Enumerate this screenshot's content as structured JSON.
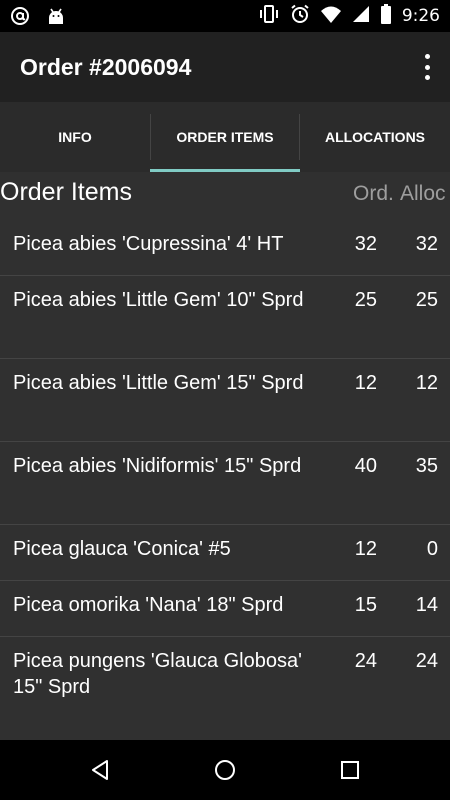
{
  "status_bar": {
    "time": "9:26",
    "left_icons": [
      "at-sign-icon",
      "android-icon"
    ],
    "right_icons": [
      "vibrate-icon",
      "alarm-icon",
      "wifi-icon",
      "cell-signal-icon",
      "battery-icon"
    ]
  },
  "app_bar": {
    "title": "Order #2006094",
    "overflow_icon": "more-vert-icon"
  },
  "tabs": [
    {
      "label": "INFO",
      "selected": false
    },
    {
      "label": "ORDER ITEMS",
      "selected": true
    },
    {
      "label": "ALLOCATIONS",
      "selected": false
    }
  ],
  "section": {
    "title": "Order Items",
    "col_ord": "Ord.",
    "col_alloc": "Alloc"
  },
  "items": [
    {
      "name": "Picea abies 'Cupressina' 4' HT",
      "ord": "32",
      "alloc": "32"
    },
    {
      "name": "Picea abies 'Little Gem' 10\" Sprd",
      "ord": "25",
      "alloc": "25"
    },
    {
      "name": "Picea abies 'Little Gem' 15\" Sprd",
      "ord": "12",
      "alloc": "12"
    },
    {
      "name": "Picea abies 'Nidiformis' 15\" Sprd",
      "ord": "40",
      "alloc": "35"
    },
    {
      "name": "Picea glauca 'Conica' #5",
      "ord": "12",
      "alloc": "0"
    },
    {
      "name": "Picea omorika 'Nana' 18\" Sprd",
      "ord": "15",
      "alloc": "14"
    },
    {
      "name": "Picea pungens 'Glauca Globosa' 15\" Sprd",
      "ord": "24",
      "alloc": "24"
    }
  ],
  "nav_bar": {
    "icons": [
      "back-icon",
      "home-icon",
      "recents-icon"
    ]
  },
  "colors": {
    "accent": "#80cbc4",
    "background": "#303030",
    "app_bar": "#212121"
  }
}
